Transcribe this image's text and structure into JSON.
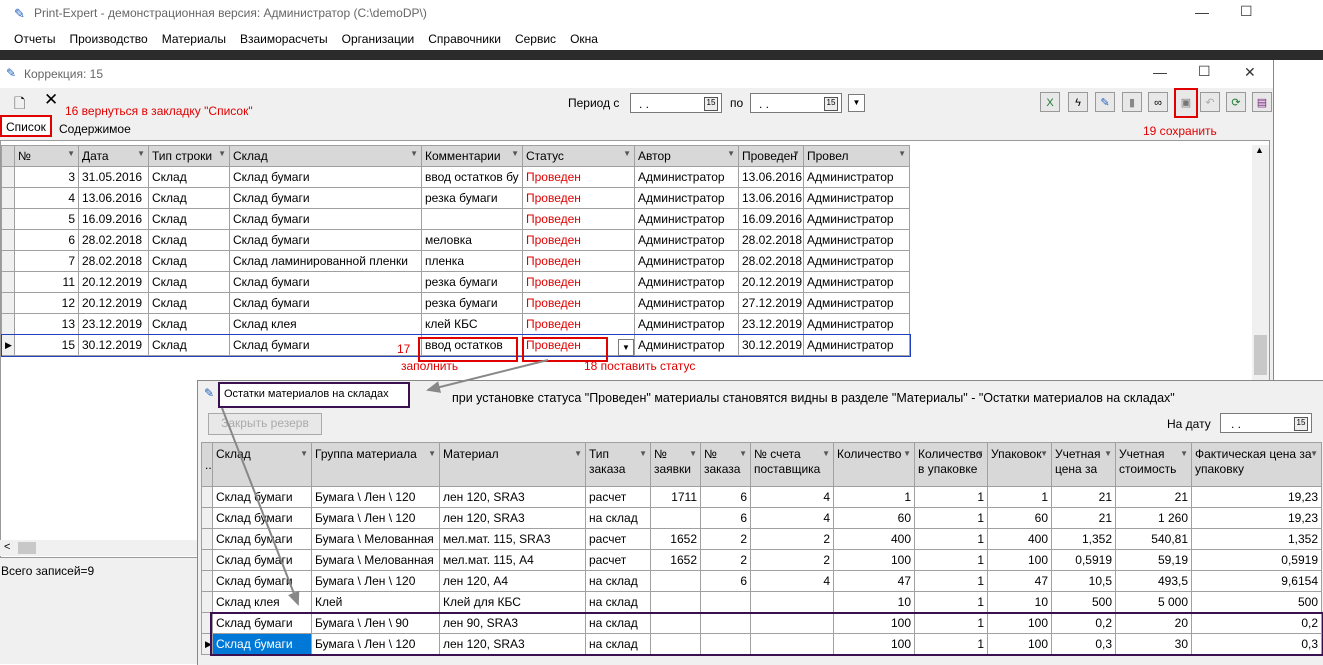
{
  "app": {
    "title": "Print-Expert - демонстрационная версия: Администратор (C:\\demoDP\\)",
    "menu": [
      "Отчеты",
      "Производство",
      "Материалы",
      "Взаиморасчеты",
      "Организации",
      "Справочники",
      "Сервис",
      "Окна"
    ]
  },
  "correction": {
    "title": "Коррекция: 15",
    "tabs": [
      "Список",
      "Содержимое"
    ],
    "period_label": "Период с",
    "period_from": " .  .",
    "period_to_label": "по",
    "period_to": " .  .",
    "columns": [
      "№",
      "Дата",
      "Тип строки",
      "Склад",
      "Комментарии",
      "Статус",
      "Автор",
      "Проведен",
      "Провел"
    ],
    "rows": [
      [
        "3",
        "31.05.2016",
        "Склад",
        "Склад бумаги",
        "ввод остатков бу",
        "Проведен",
        "Администратор",
        "13.06.2016",
        "Администратор"
      ],
      [
        "4",
        "13.06.2016",
        "Склад",
        "Склад бумаги",
        "резка бумаги",
        "Проведен",
        "Администратор",
        "13.06.2016",
        "Администратор"
      ],
      [
        "5",
        "16.09.2016",
        "Склад",
        "Склад бумаги",
        "",
        "Проведен",
        "Администратор",
        "16.09.2016",
        "Администратор"
      ],
      [
        "6",
        "28.02.2018",
        "Склад",
        "Склад бумаги",
        "меловка",
        "Проведен",
        "Администратор",
        "28.02.2018",
        "Администратор"
      ],
      [
        "7",
        "28.02.2018",
        "Склад",
        "Склад ламинированной пленки",
        "пленка",
        "Проведен",
        "Администратор",
        "28.02.2018",
        "Администратор"
      ],
      [
        "11",
        "20.12.2019",
        "Склад",
        "Склад бумаги",
        "резка бумаги",
        "Проведен",
        "Администратор",
        "20.12.2019",
        "Администратор"
      ],
      [
        "12",
        "20.12.2019",
        "Склад",
        "Склад бумаги",
        "резка бумаги",
        "Проведен",
        "Администратор",
        "27.12.2019",
        "Администратор"
      ],
      [
        "13",
        "23.12.2019",
        "Склад",
        "Склад клея",
        "клей КБС",
        "Проведен",
        "Администратор",
        "23.12.2019",
        "Администратор"
      ],
      [
        "15",
        "30.12.2019",
        "Склад",
        "Склад бумаги",
        "ввод остатков",
        "Проведен",
        "Администратор",
        "30.12.2019",
        "Администратор"
      ]
    ],
    "total": "Всего записей=9"
  },
  "annotations": {
    "a16": "16  вернуться в закладку \"Список\"",
    "a17": "17",
    "a17b": "заполнить",
    "a18": "18  поставить статус",
    "a19": "19 сохранить",
    "note": "при установке статуса \"Проведен\" материалы становятся видны в разделе \"Материалы\" - \"Остатки материалов на складах\""
  },
  "stock": {
    "title": "Остатки материалов на складах",
    "reserve_button": "Закрыть резерв",
    "date_label": "На дату",
    "date_value": " .  .",
    "columns": [
      "Склад",
      "Группа материала",
      "Материал",
      "Тип заказа",
      "№ заявки",
      "№ заказа",
      "№ счета поставщика",
      "Количество",
      "Количество в упаковке",
      "Упаковок",
      "Учетная цена за",
      "Учетная стоимость",
      "Фактическая цена за упаковку"
    ],
    "rows": [
      [
        "Склад бумаги",
        "Бумага \\ Лен \\ 120",
        "лен 120, SRA3",
        "расчет",
        "1711",
        "6",
        "4",
        "1",
        "1",
        "1",
        "21",
        "21",
        "19,23"
      ],
      [
        "Склад бумаги",
        "Бумага \\ Лен \\ 120",
        "лен 120, SRA3",
        "на склад",
        "",
        "6",
        "4",
        "60",
        "1",
        "60",
        "21",
        "1 260",
        "19,23"
      ],
      [
        "Склад бумаги",
        "Бумага \\ Мелованная",
        "мел.мат. 115, SRA3",
        "расчет",
        "1652",
        "2",
        "2",
        "400",
        "1",
        "400",
        "1,352",
        "540,81",
        "1,352"
      ],
      [
        "Склад бумаги",
        "Бумага \\ Мелованная",
        "мел.мат. 115, А4",
        "расчет",
        "1652",
        "2",
        "2",
        "100",
        "1",
        "100",
        "0,5919",
        "59,19",
        "0,5919"
      ],
      [
        "Склад бумаги",
        "Бумага \\ Лен \\ 120",
        "лен 120, А4",
        "на склад",
        "",
        "6",
        "4",
        "47",
        "1",
        "47",
        "10,5",
        "493,5",
        "9,6154"
      ],
      [
        "Склад клея",
        "Клей",
        "Клей для КБС",
        "на склад",
        "",
        "",
        "",
        "10",
        "1",
        "10",
        "500",
        "5 000",
        "500"
      ],
      [
        "Склад бумаги",
        "Бумага \\ Лен \\ 90",
        "лен 90, SRA3",
        "на склад",
        "",
        "",
        "",
        "100",
        "1",
        "100",
        "0,2",
        "20",
        "0,2"
      ],
      [
        "Склад бумаги",
        "Бумага \\ Лен \\ 120",
        "лен 120, SRA3",
        "на склад",
        "",
        "",
        "",
        "100",
        "1",
        "100",
        "0,3",
        "30",
        "0,3"
      ]
    ]
  }
}
